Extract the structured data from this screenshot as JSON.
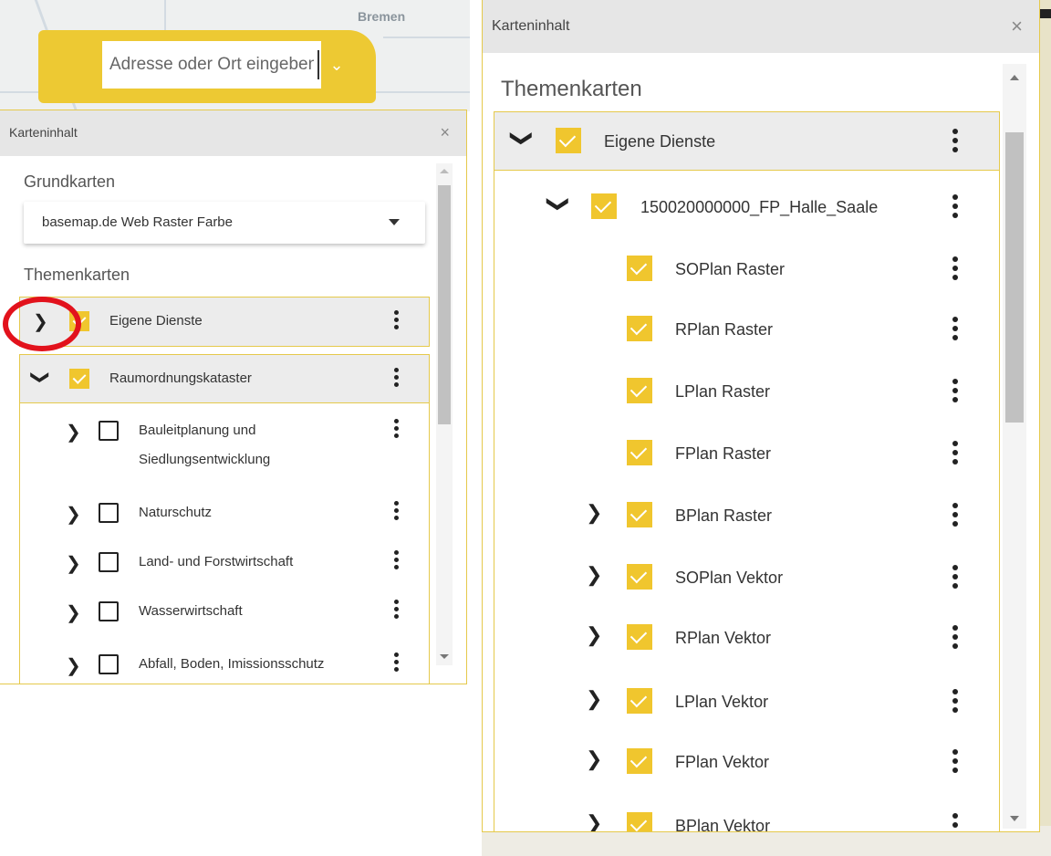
{
  "left_panel": {
    "map_city": "Bremen",
    "search": {
      "placeholder": "Adresse oder Ort eingeben"
    },
    "header_title": "Karteninhalt",
    "close_symbol": "×",
    "base_section_title": "Grundkarten",
    "base_map_selected": "basemap.de Web Raster Farbe",
    "theme_section_title": "Themenkarten",
    "items": [
      {
        "label": "Eigene Dienste",
        "checked": true,
        "expanded": false
      },
      {
        "label": "Raumordnungskataster",
        "checked": true,
        "expanded": true
      },
      {
        "label_line1": "Bauleitplanung und",
        "label_line2": "Siedlungsentwicklung",
        "checked": false
      },
      {
        "label": "Naturschutz",
        "checked": false
      },
      {
        "label": "Land- und Forstwirtschaft",
        "checked": false
      },
      {
        "label": "Wasserwirtschaft",
        "checked": false
      },
      {
        "label": "Abfall, Boden, Imissionsschutz",
        "checked": false
      }
    ]
  },
  "right_panel": {
    "header_title": "Karteninhalt",
    "close_symbol": "×",
    "theme_section_title": "Themenkarten",
    "items": [
      {
        "label": "Eigene Dienste",
        "checked": true,
        "expanded": true
      },
      {
        "label": "150020000000_FP_Halle_Saale",
        "checked": true,
        "expanded": true
      },
      {
        "label": "SOPlan Raster",
        "checked": true
      },
      {
        "label": "RPlan Raster",
        "checked": true
      },
      {
        "label": "LPlan Raster",
        "checked": true
      },
      {
        "label": "FPlan Raster",
        "checked": true
      },
      {
        "label": "BPlan Raster",
        "checked": true,
        "expandable": true
      },
      {
        "label": "SOPlan Vektor",
        "checked": true,
        "expandable": true
      },
      {
        "label": "RPlan Vektor",
        "checked": true,
        "expandable": true
      },
      {
        "label": "LPlan Vektor",
        "checked": true,
        "expandable": true
      },
      {
        "label": "FPlan Vektor",
        "checked": true,
        "expandable": true
      },
      {
        "label": "BPlan Vektor",
        "checked": true,
        "expandable": true
      }
    ]
  },
  "colors": {
    "accent": "#f0c62e",
    "annotation": "#e2121c",
    "header": "#e6e6e6"
  },
  "icons": [
    "chevron-right-icon",
    "chevron-down-icon",
    "checkbox-icon",
    "more-vert-icon",
    "close-icon"
  ]
}
